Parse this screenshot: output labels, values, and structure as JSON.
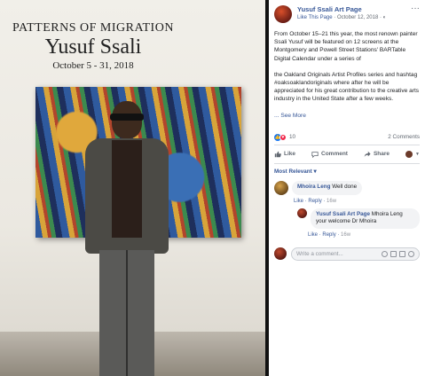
{
  "photo": {
    "exhibit_title": "PATTERNS OF MIGRATION",
    "artist_name": "Yusuf Ssali",
    "dates": "October 5 - 31, 2018"
  },
  "header": {
    "page_name": "Yusuf Ssali Art Page",
    "like_link": "Like This Page",
    "date": "October 12, 2018",
    "separator": "·",
    "more": "···"
  },
  "post": {
    "paragraph1": "From October 15–21 this year, the most renown painter Ssali Yusuf will be featured on 12 screens at the Montgomery and Powell Street Stations' BARTable Digital Calendar under a series of",
    "paragraph2": "the Oakland Originals Artist Profiles series and hashtag #oaksoaklandoriginals where after he will be appreciated for his great contribution to the creative arts industry in the United State after a few weeks.",
    "see_more": "... See More"
  },
  "reactions": {
    "count": "10",
    "comments": "2 Comments"
  },
  "actions": {
    "like": "Like",
    "comment": "Comment",
    "share": "Share"
  },
  "sort": {
    "label": "Most Relevant ▾"
  },
  "comments": [
    {
      "author": "Mhoira Leng",
      "text": "Well done",
      "like": "Like",
      "reply": "Reply",
      "time": "16w"
    },
    {
      "author": "Yusuf Ssali Art Page",
      "text": "Mhoira Leng your welcome Dr Mhoira",
      "like": "Like",
      "reply": "Reply",
      "time": "16w"
    }
  ],
  "composer": {
    "placeholder": "Write a comment..."
  },
  "colors": {
    "link": "#385898",
    "like": "#1877f2",
    "love": "#f0284a"
  }
}
